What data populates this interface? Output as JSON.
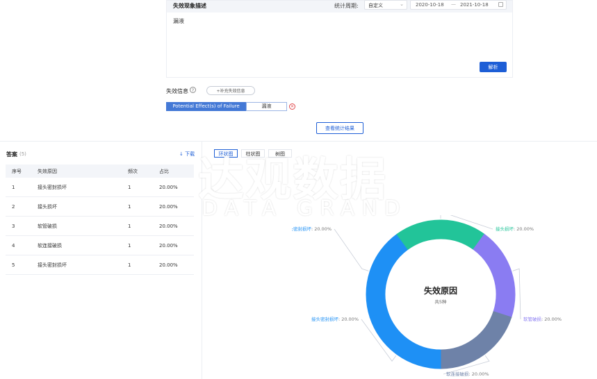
{
  "description": {
    "title": "失效现象描述",
    "period_label": "统计周期:",
    "period_value": "自定义",
    "date_start": "2020-10-18",
    "date_sep": "—",
    "date_end": "2021-10-18",
    "text": "漏液",
    "parse_button": "解析"
  },
  "failure_info": {
    "label": "失效信息",
    "supplement_button": "+补充失效信息",
    "effect_tag": "Potential Effect(s) of Failure",
    "effect_value": "漏液"
  },
  "view_button": "查看统计结果",
  "answers": {
    "title": "答案",
    "count": "(5)",
    "download": "↓ 下载",
    "columns": [
      "序号",
      "失效原因",
      "频次",
      "占比"
    ],
    "rows": [
      [
        "1",
        "接头密封损坏",
        "1",
        "20.00%"
      ],
      [
        "2",
        "接头损坏",
        "1",
        "20.00%"
      ],
      [
        "3",
        "软管破损",
        "1",
        "20.00%"
      ],
      [
        "4",
        "软连接破损",
        "1",
        "20.00%"
      ],
      [
        "5",
        "接头密封损坏",
        "1",
        "20.00%"
      ]
    ]
  },
  "chart_tabs": [
    "环状图",
    "柱状图",
    "树图"
  ],
  "watermark": {
    "cn": "达观数据",
    "en": "DATA GRAND"
  },
  "chart_data": {
    "type": "pie",
    "donut": true,
    "center_title": "失效原因",
    "center_subtitle": "共5种",
    "slices": [
      {
        "label": "接头密封损坏",
        "value": 20.0,
        "color": "#1e90f5"
      },
      {
        "label": "接头损坏",
        "value": 20.0,
        "color": "#22c499"
      },
      {
        "label": "软管破损",
        "value": 20.0,
        "color": "#8a7cf2"
      },
      {
        "label": "软连接破损",
        "value": 20.0,
        "color": "#6e82a8"
      },
      {
        "label": "接头密封损坏",
        "value": 20.0,
        "color": "#1e90f5"
      }
    ],
    "label_suffix": ":  20.00%"
  },
  "colors": {
    "accent": "#1d5ed6",
    "danger": "#e0484b"
  }
}
